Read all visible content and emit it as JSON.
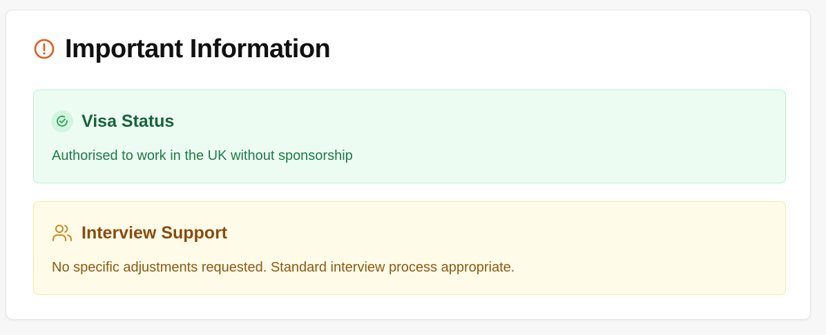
{
  "header": {
    "icon": "alert-circle-icon",
    "title": "Important Information"
  },
  "visa": {
    "icon": "check-circle-icon",
    "title": "Visa Status",
    "text": "Authorised to work in the UK without sponsorship"
  },
  "interview": {
    "icon": "users-icon",
    "title": "Interview Support",
    "text": "No specific adjustments requested. Standard interview process appropriate."
  },
  "colors": {
    "alert": "#e05a1c",
    "green_accent": "#22a35a",
    "yellow_accent": "#c98a1a"
  }
}
